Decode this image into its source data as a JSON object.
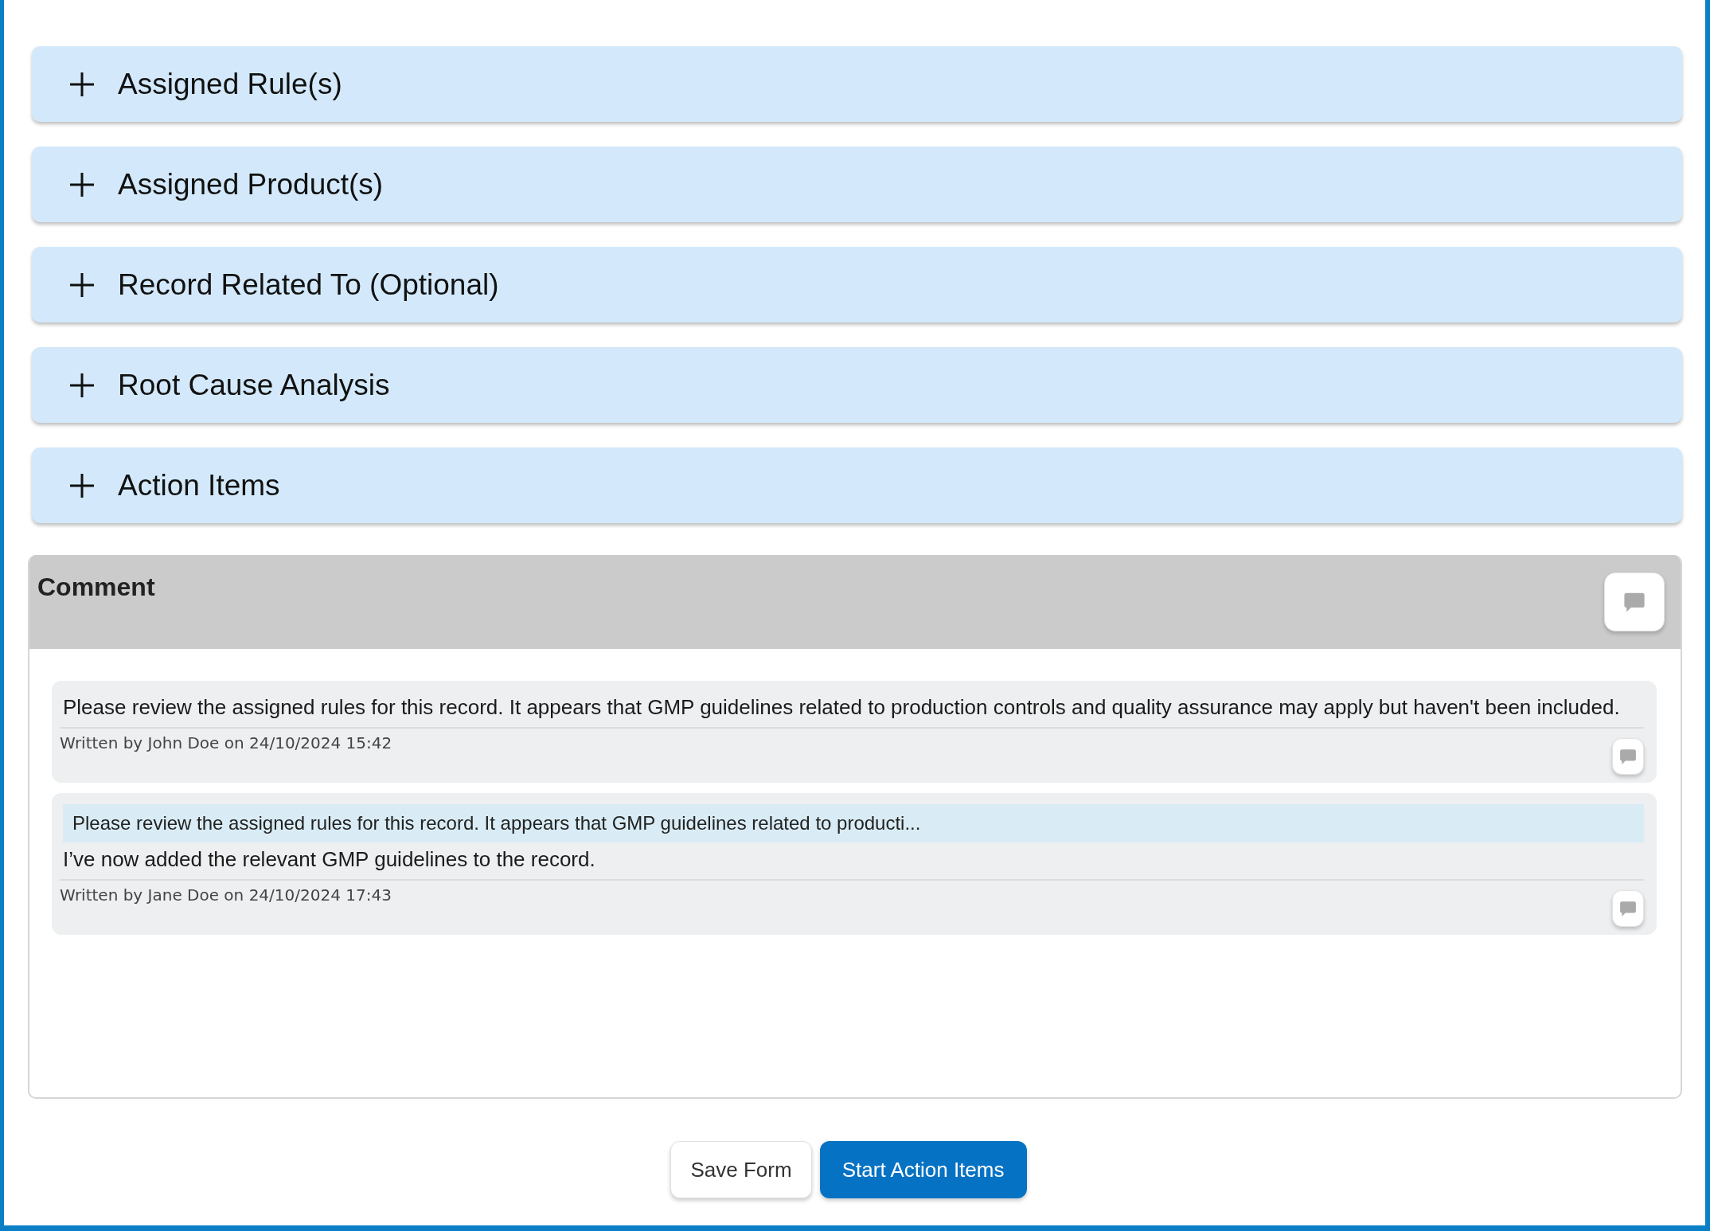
{
  "sections": [
    {
      "title": "Assigned Rule(s)",
      "expanded": false
    },
    {
      "title": "Assigned Product(s)",
      "expanded": false
    },
    {
      "title": "Record Related To (Optional)",
      "expanded": false
    },
    {
      "title": "Root Cause Analysis",
      "expanded": false
    },
    {
      "title": "Action Items",
      "expanded": false
    }
  ],
  "comment": {
    "title": "Comment",
    "entries": [
      {
        "text": "Please review the assigned rules for this record. It appears that GMP guidelines related to production controls and quality assurance may apply but haven't been included.",
        "meta": "Written by John Doe on 24/10/2024 15:42"
      },
      {
        "quote": "Please review the assigned rules for this record. It appears that GMP guidelines related to producti...",
        "text": "I’ve now added the relevant GMP guidelines to the record.",
        "meta": "Written by Jane Doe on 24/10/2024 17:43"
      }
    ]
  },
  "buttons": [
    {
      "label": "Save Form",
      "kind": "secondary"
    },
    {
      "label": "Start Action Items",
      "kind": "primary"
    }
  ]
}
